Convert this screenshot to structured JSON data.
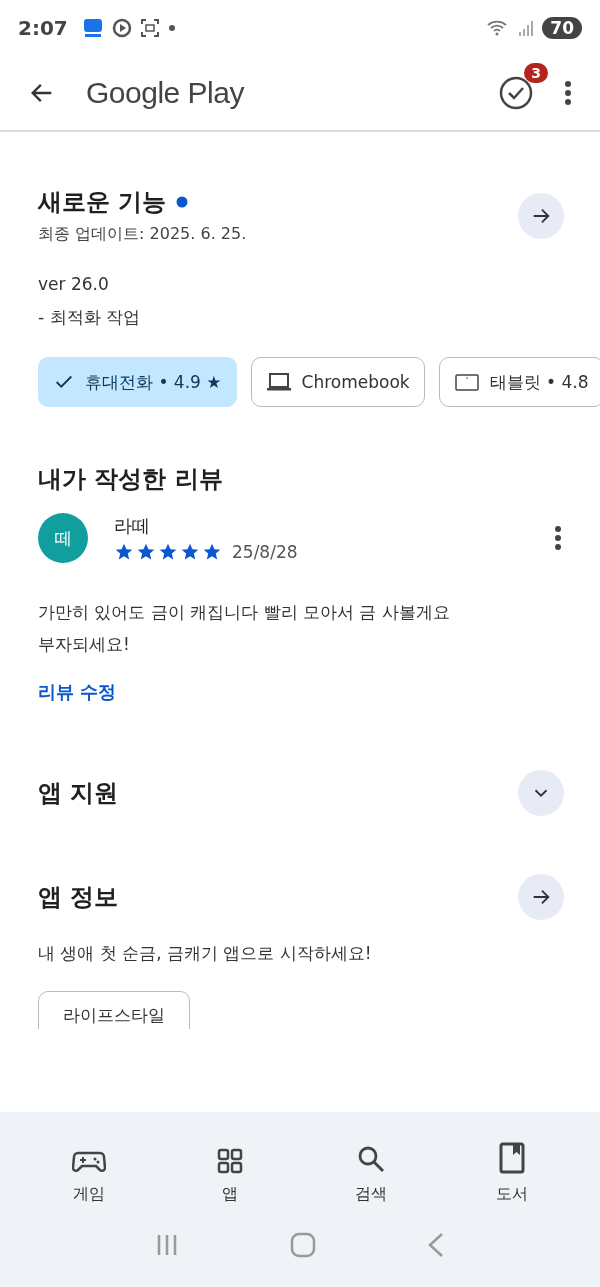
{
  "status_bar": {
    "time": "2:07",
    "battery": "70"
  },
  "app_bar": {
    "title": "Google Play",
    "badge": "3"
  },
  "whats_new": {
    "title": "새로운 기능",
    "updated": "최종 업데이트: 2025. 6. 25.",
    "lines": [
      "ver 26.0",
      "- 최적화 작업"
    ]
  },
  "devices": [
    {
      "label": "휴대전화 • 4.9 ★",
      "selected": true
    },
    {
      "label": "Chromebook",
      "kind": "laptop",
      "selected": false
    },
    {
      "label": "태블릿 • 4.8",
      "kind": "tablet",
      "selected": false
    }
  ],
  "my_review": {
    "heading": "내가 작성한 리뷰",
    "avatar": "떼",
    "author": "라떼",
    "stars": 5,
    "date": "25/8/28",
    "text": "가만히 있어도 금이 캐집니다 빨리 모아서 금 사볼게요\n부자되세요!",
    "edit_link": "리뷰 수정"
  },
  "app_support": {
    "title": "앱 지원",
    "expanded": false
  },
  "app_info": {
    "title": "앱 정보",
    "description": "내 생애 첫 순금, 금캐기 앱으로 시작하세요!",
    "tag": "라이프스타일"
  },
  "bottom_nav": [
    {
      "label": "게임",
      "kind": "games"
    },
    {
      "label": "앱",
      "kind": "apps"
    },
    {
      "label": "검색",
      "kind": "search"
    },
    {
      "label": "도서",
      "kind": "books"
    }
  ]
}
